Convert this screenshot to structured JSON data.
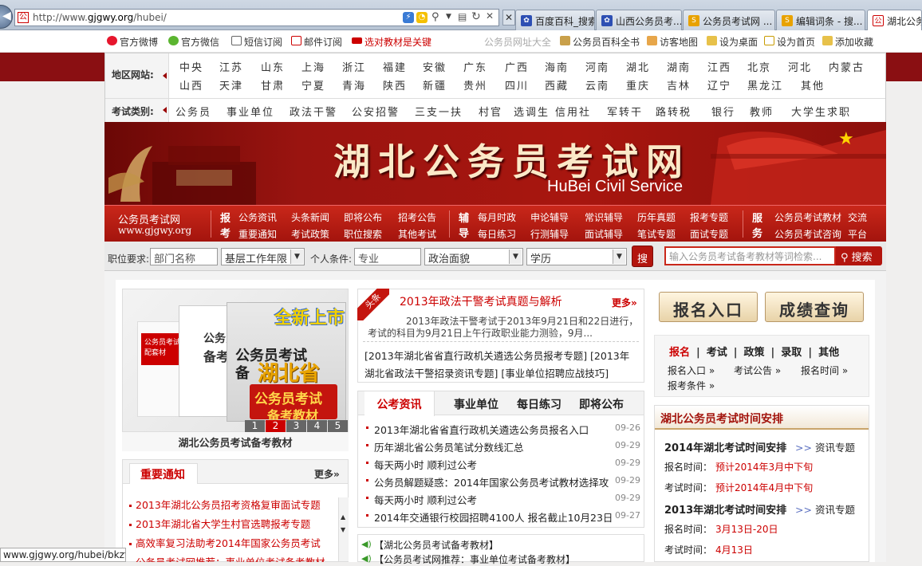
{
  "browser": {
    "url_prefix": "http://www.",
    "url_domain": "gjgwy.org",
    "url_path": "/hubei/",
    "tabs": [
      {
        "label": "百度百科_搜索...",
        "icon": "paw-icon"
      },
      {
        "label": "山西公务员考...",
        "icon": "paw-icon"
      },
      {
        "label": "公务员考试网 ...",
        "icon": "sogou-icon"
      },
      {
        "label": "编辑词条 - 搜...",
        "icon": "sogou-icon"
      },
      {
        "label": "湖北公务",
        "icon": "site-icon"
      }
    ],
    "status_url": "www.gjgwy.org/hubei/bkzt/"
  },
  "topbar": {
    "links": [
      "官方微博",
      "官方微信",
      "短信订阅",
      "邮件订阅",
      "选对教材是关键"
    ],
    "right_links": [
      "公务员网址大全",
      "公务员百科全书",
      "访客地图",
      "设为桌面",
      "设为首页",
      "添加收藏"
    ]
  },
  "region": {
    "label": "地区网站:",
    "row1": [
      "中央",
      "江苏",
      "山东",
      "上海",
      "浙江",
      "福建",
      "安徽",
      "广东",
      "广西",
      "海南",
      "河南",
      "湖北",
      "湖南",
      "江西",
      "北京",
      "河北",
      "内蒙古"
    ],
    "row2": [
      "山西",
      "天津",
      "甘肃",
      "宁夏",
      "青海",
      "陕西",
      "新疆",
      "贵州",
      "四川",
      "西藏",
      "云南",
      "重庆",
      "吉林",
      "辽宁",
      "黑龙江",
      "其他"
    ]
  },
  "exam_types": {
    "label": "考试类别:",
    "items": [
      "公务员",
      "事业单位",
      "政法干警",
      "公安招警",
      "三支一扶",
      "村官",
      "选调生",
      "信用社",
      "军转干",
      "路转税",
      "银行",
      "教师",
      "大学生求职"
    ]
  },
  "banner": {
    "title": "湖北公务员考试网",
    "subtitle": "HuBei Civil Service"
  },
  "nav": {
    "site_name": "公务员考试网",
    "site_url": "www.gjgwy.org",
    "group1_label": [
      "报",
      "考"
    ],
    "group1_row1": [
      "公务资讯",
      "头条新闻",
      "即将公布",
      "招考公告"
    ],
    "group1_row2": [
      "重要通知",
      "考试政策",
      "职位搜索",
      "其他考试"
    ],
    "group2_label": [
      "辅",
      "导"
    ],
    "group2_row1": [
      "每月时政",
      "申论辅导",
      "常识辅导",
      "历年真题",
      "报考专题"
    ],
    "group2_row2": [
      "每日练习",
      "行测辅导",
      "面试辅导",
      "笔试专题",
      "面试专题"
    ],
    "group3_label": [
      "服",
      "务"
    ],
    "group3_row1": [
      "公务员考试教材",
      "交流"
    ],
    "group3_row2": [
      "公务员考试咨询",
      "平台"
    ]
  },
  "search": {
    "job_label": "职位要求:",
    "dept_placeholder": "部门名称",
    "years_value": "基层工作年限",
    "personal_label": "个人条件:",
    "major_placeholder": "专业",
    "politics_value": "政治面貌",
    "edu_value": "学历",
    "search_small": "搜",
    "keyword_placeholder": "输入公务员考试备考教材等词检索...",
    "search_button": "搜索"
  },
  "slider": {
    "caption": "湖北公务员考试备考教材",
    "pages": [
      "1",
      "2",
      "3",
      "4",
      "5"
    ],
    "book_top": "全新上市",
    "book_line1": "公务员考试",
    "book_line2": "备",
    "book_line3": "湖北省",
    "book_line4": "公务员考试",
    "book_line5": "备考教材",
    "book_left1": "公务员考试",
    "book_left2": "备考",
    "book_side": "公务员考试配套材"
  },
  "notices": {
    "title": "重要通知",
    "more": "更多»",
    "items": [
      "2013年湖北公务员招考资格复审面试专题",
      "2013年湖北省大学生村官选聘报考专题",
      "高效率复习法助考2014年国家公务员考试",
      "公务员考试网推荐：事业单位考试备考教材"
    ]
  },
  "headline": {
    "tag": "头条",
    "title": "2013年政法干警考试真题与解析",
    "more": "更多»",
    "summary_1": "2013年政法干警考试于2013年9月21日和22日进行，",
    "summary_2": "考试的科目为9月21日上午行政职业能力测验，9月...",
    "links_1": "[2013年湖北省省直行政机关遴选公务员报考专题] [2013年",
    "links_2": "湖北省政法干警招录资讯专题] [事业单位招聘应战技巧]"
  },
  "news": {
    "tabs": [
      "公考资讯",
      "事业单位",
      "每日练习",
      "即将公布"
    ],
    "items": [
      {
        "title": "2013年湖北省省直行政机关遴选公务员报名入口",
        "date": "09-26"
      },
      {
        "title": "历年湖北省公务员笔试分数线汇总",
        "date": "09-29"
      },
      {
        "title": "每天两小时 顺利过公考",
        "date": "09-29"
      },
      {
        "title": "公务员解题疑惑：2014年国家公务员考试教材选择攻",
        "date": "09-29"
      },
      {
        "title": "每天两小时 顺利过公考",
        "date": "09-29"
      },
      {
        "title": "2014年交通银行校园招聘4100人 报名截止10月23日",
        "date": "09-27"
      }
    ],
    "speaker_items": [
      "【湖北公务员考试备考教材】",
      "【公务员考试网推荐：事业单位考试备考教材】"
    ]
  },
  "right": {
    "btn_register": "报名入口",
    "btn_score": "成绩查询",
    "quick_tabs": [
      "报名",
      "考试",
      "政策",
      "录取",
      "其他"
    ],
    "quick_links": [
      "报名入口 »",
      "考试公告 »",
      "报名时间 »",
      "报考条件 »"
    ],
    "schedule_title": "湖北公务员考试时间安排",
    "s1_title": "2014年湖北考试时间安排",
    "s1_link": "资讯专题",
    "s1_reg_label": "报名时间：",
    "s1_reg_value": "预计2014年3月中下旬",
    "s1_exam_label": "考试时间：",
    "s1_exam_value": "预计2014年4月中下旬",
    "s2_title": "2013年湖北考试时间安排",
    "s2_link": "资讯专题",
    "s2_reg_label": "报名时间：",
    "s2_reg_value": "3月13日-20日",
    "s2_exam_label": "考试时间：",
    "s2_exam_value": "4月13日"
  },
  "colors": {
    "brand_red": "#a3140d",
    "dark_red": "#8a0f12",
    "link_red": "#cc0000"
  }
}
